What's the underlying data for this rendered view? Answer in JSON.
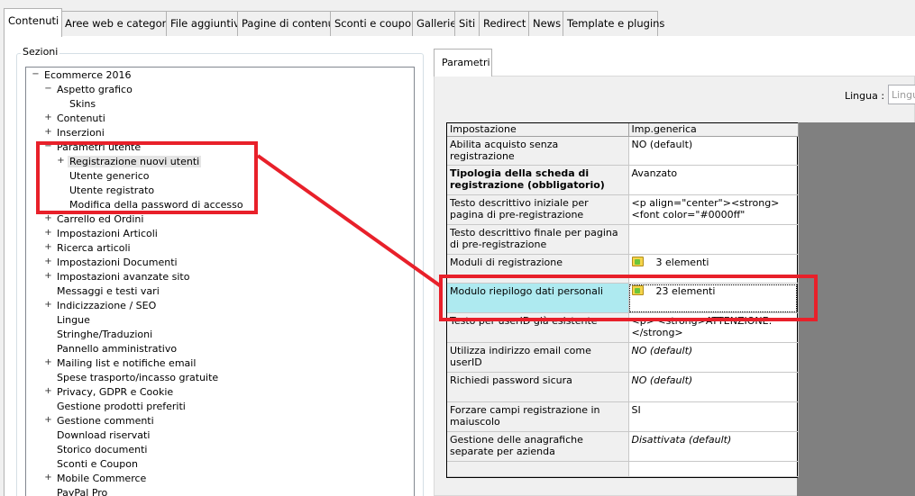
{
  "tabs": [
    "Contenuti",
    "Aree web e categorie",
    "File aggiuntivi",
    "Pagine di contenuti",
    "Sconti e coupon",
    "Gallerie",
    "Siti",
    "Redirect",
    "News",
    "Template e plugins"
  ],
  "sections_title": "Sezioni",
  "tree": [
    {
      "label": "Ecommerce 2016",
      "level": 0,
      "expander": "−"
    },
    {
      "label": "Aspetto grafico",
      "level": 1,
      "expander": "−"
    },
    {
      "label": "Skins",
      "level": 2,
      "expander": ""
    },
    {
      "label": "Contenuti",
      "level": 1,
      "expander": "+"
    },
    {
      "label": "Inserzioni",
      "level": 1,
      "expander": "+"
    },
    {
      "label": "Parametri utente",
      "level": 1,
      "expander": "−"
    },
    {
      "label": "Registrazione nuovi utenti",
      "level": 2,
      "expander": "+",
      "selected": true
    },
    {
      "label": "Utente generico",
      "level": 2,
      "expander": ""
    },
    {
      "label": "Utente registrato",
      "level": 2,
      "expander": ""
    },
    {
      "label": "Modifica della password di accesso",
      "level": 2,
      "expander": ""
    },
    {
      "label": "Carrello ed Ordini",
      "level": 1,
      "expander": "+"
    },
    {
      "label": "Impostazioni Articoli",
      "level": 1,
      "expander": "+"
    },
    {
      "label": "Ricerca articoli",
      "level": 1,
      "expander": "+"
    },
    {
      "label": "Impostazioni Documenti",
      "level": 1,
      "expander": "+"
    },
    {
      "label": "Impostazioni avanzate sito",
      "level": 1,
      "expander": "+"
    },
    {
      "label": "Messaggi e testi vari",
      "level": 1,
      "expander": ""
    },
    {
      "label": "Indicizzazione / SEO",
      "level": 1,
      "expander": "+"
    },
    {
      "label": "Lingue",
      "level": 1,
      "expander": ""
    },
    {
      "label": "Stringhe/Traduzioni",
      "level": 1,
      "expander": ""
    },
    {
      "label": "Pannello amministrativo",
      "level": 1,
      "expander": ""
    },
    {
      "label": "Mailing list e notifiche email",
      "level": 1,
      "expander": "+"
    },
    {
      "label": "Spese trasporto/incasso gratuite",
      "level": 1,
      "expander": ""
    },
    {
      "label": "Privacy, GDPR e Cookie",
      "level": 1,
      "expander": "+"
    },
    {
      "label": "Gestione prodotti preferiti",
      "level": 1,
      "expander": ""
    },
    {
      "label": "Gestione commenti",
      "level": 1,
      "expander": "+"
    },
    {
      "label": "Download riservati",
      "level": 1,
      "expander": ""
    },
    {
      "label": "Storico documenti",
      "level": 1,
      "expander": ""
    },
    {
      "label": "Sconti e Coupon",
      "level": 1,
      "expander": ""
    },
    {
      "label": "Mobile Commerce",
      "level": 1,
      "expander": "+"
    },
    {
      "label": "PayPal Pro",
      "level": 1,
      "expander": ""
    }
  ],
  "params_tab": "Parametri",
  "lingua": {
    "label": "Lingua :",
    "value": "Lingu"
  },
  "grid": {
    "headers": [
      "Impostazione",
      "Imp.generica"
    ],
    "rows": [
      {
        "key": "Abilita acquisto senza registrazione",
        "value": "NO (default)"
      },
      {
        "key": "Tipologia della scheda di registrazione (obbligatorio)",
        "value": "Avanzato",
        "bold": true
      },
      {
        "key": "Testo descrittivo iniziale per pagina di pre-registrazione",
        "value": "<p align=\"center\"><strong><font color=\"#0000ff\""
      },
      {
        "key": "Testo descrittivo finale per pagina di pre-registrazione",
        "value": ""
      },
      {
        "key": "Moduli di registrazione",
        "value": "3 elementi",
        "icon": "folder-icon"
      },
      {
        "key": "Modulo riepilogo dati personali",
        "value": "23 elementi",
        "icon": "folder-icon",
        "highlight": true
      },
      {
        "key": "Testo per userID già esistente",
        "value": "<p> <strong>ATTENZIONE:</strong>"
      },
      {
        "key": "Utilizza indirizzo email come userID",
        "value": "NO (default)",
        "italic": true
      },
      {
        "key": "Richiedi password sicura",
        "value": "NO (default)",
        "italic": true
      },
      {
        "key": "Forzare campi registrazione in maiuscolo",
        "value": "SI"
      },
      {
        "key": "Gestione delle anagrafiche separate per azienda",
        "value": "Disattivata (default)",
        "italic": true
      },
      {
        "key": "",
        "value": ""
      }
    ]
  },
  "colors": {
    "annotation": "#e8202a",
    "highlight": "#aeeaf0",
    "selection": "#e5e5e5"
  }
}
